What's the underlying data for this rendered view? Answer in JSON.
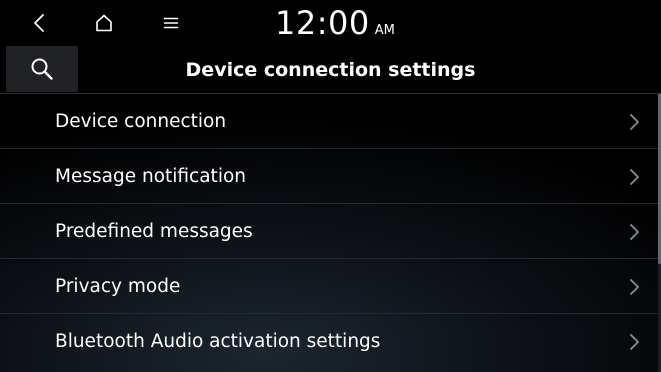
{
  "status_bar": {
    "time": "12:00",
    "ampm": "AM",
    "icons": {
      "back": "back-chevron-icon",
      "home": "home-icon",
      "menu": "menu-icon"
    }
  },
  "header": {
    "title": "Device connection settings",
    "search_icon": "search-icon"
  },
  "settings": {
    "items": [
      {
        "label": "Device connection"
      },
      {
        "label": "Message notification"
      },
      {
        "label": "Predefined messages"
      },
      {
        "label": "Privacy mode"
      },
      {
        "label": "Bluetooth Audio activation settings"
      }
    ]
  },
  "colors": {
    "background": "#000000",
    "text": "#ffffff",
    "search_button_bg": "#202225",
    "divider": "#25292e",
    "chevron": "#8a8f95"
  }
}
